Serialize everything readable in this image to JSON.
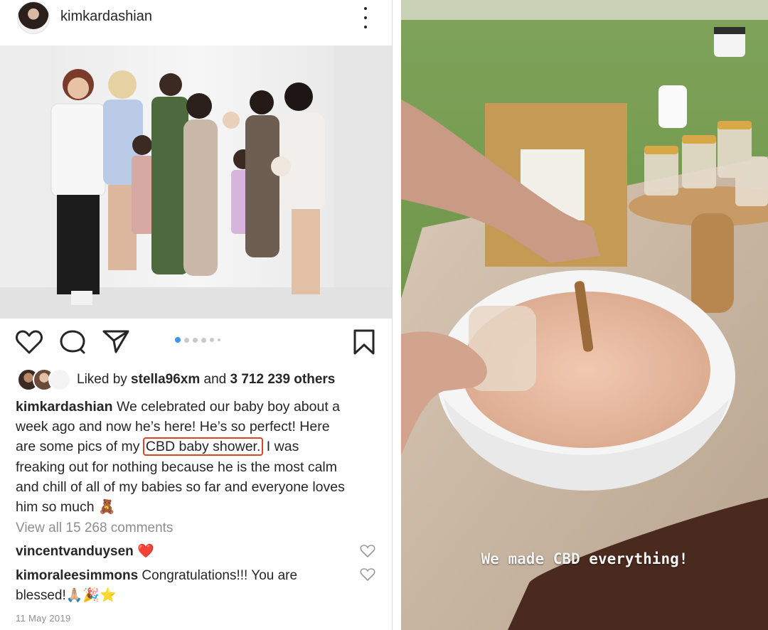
{
  "post": {
    "username": "kimkardashian",
    "more_icon": "ellipsis-vertical-icon",
    "carousel": {
      "count": 6,
      "active": 1
    },
    "likes": {
      "prefix": "Liked by ",
      "user": "stella96xm",
      "middle": " and ",
      "count": "3 712 239 others"
    },
    "caption": {
      "username": "kimkardashian",
      "line1": " We celebrated our baby boy about a",
      "line2": "week ago and now he’s here! He’s so perfect!  Here",
      "line3_before": "are some pics of my ",
      "line3_highlight": "CBD baby shower.",
      "line3_after": " I was",
      "line4": "freaking out for nothing because he is the most calm",
      "line5": "and chill of all of my babies so far and everyone loves",
      "line6": "him so much 🧸"
    },
    "view_comments": "View all 15 268 comments",
    "comments": [
      {
        "username": "vincentvanduysen",
        "text": " ❤️"
      },
      {
        "username": "kimoraleesimmons",
        "text": " Congratulations!!! You are",
        "text2": "blessed!🙏🏼🎉⭐"
      }
    ],
    "date": "11 May 2019"
  },
  "story": {
    "caption": "We made CBD everything!"
  },
  "colors": {
    "highlight_border": "#d9472b",
    "text": "#262626",
    "muted": "#8e8e8e",
    "heart_red": "#e0263c"
  }
}
